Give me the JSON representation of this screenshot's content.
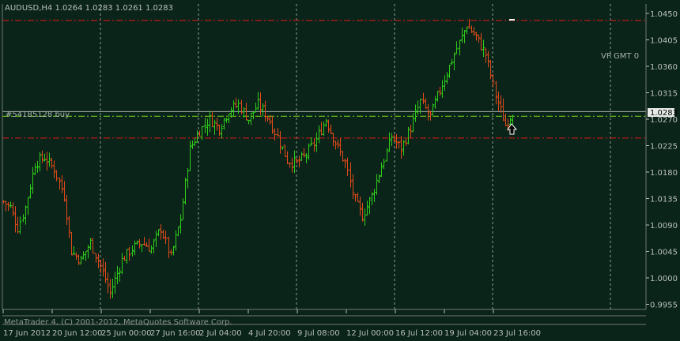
{
  "header": {
    "title": "AUDUSD,H4  1.0264 1.0283 1.0261 1.0283"
  },
  "annotations": {
    "vp_label": "VP GMT 0",
    "order_label": "#54185128 buy",
    "current_price_label": "1.0283",
    "copyright": "MetaTrader 4, (C) 2001-2012, MetaQuotes Software Corp."
  },
  "colors": {
    "background": "#0b2419",
    "grid": "#8a9a94",
    "bull": "#2ecc1a",
    "bear": "#e04a1a",
    "text": "#b8bfbc",
    "red_level": "#e01818",
    "green_level": "#7ad81a",
    "bid_line": "#a8b3ad"
  },
  "chart_data": {
    "type": "candlestick",
    "symbol": "AUDUSD",
    "timeframe": "H4",
    "ylim": [
      0.9945,
      1.046
    ],
    "y_ticks": [
      "1.0450",
      "1.0405",
      "1.0360",
      "1.0315",
      "1.0270",
      "1.0225",
      "1.0180",
      "1.0135",
      "1.0090",
      "1.0045",
      "1.0000",
      "0.9955"
    ],
    "x_ticks": [
      "17 Jun 2012",
      "20 Jun 12:00",
      "25 Jun 00:00",
      "27 Jun 16:00",
      "2 Jul 04:00",
      "4 Jul 20:00",
      "9 Jul 08:00",
      "12 Jul 00:00",
      "16 Jul 12:00",
      "19 Jul 04:00",
      "23 Jul 16:00"
    ],
    "levels": [
      {
        "name": "take-profit",
        "price": 1.0438
      },
      {
        "name": "order-open",
        "price": 1.0275
      },
      {
        "name": "stop-loss",
        "price": 1.0238
      }
    ],
    "current_price": 1.0283,
    "anchors": [
      [
        0,
        1.013
      ],
      [
        3,
        1.012
      ],
      [
        6,
        1.0085
      ],
      [
        9,
        1.012
      ],
      [
        13,
        1.0195
      ],
      [
        17,
        1.0205
      ],
      [
        21,
        1.0185
      ],
      [
        25,
        1.014
      ],
      [
        28,
        1.0045
      ],
      [
        32,
        1.003
      ],
      [
        36,
        1.006
      ],
      [
        40,
        1.002
      ],
      [
        44,
        0.9975
      ],
      [
        49,
        1.003
      ],
      [
        53,
        1.005
      ],
      [
        57,
        1.006
      ],
      [
        61,
        1.005
      ],
      [
        65,
        1.0085
      ],
      [
        69,
        1.0035
      ],
      [
        73,
        1.01
      ],
      [
        77,
        1.022
      ],
      [
        81,
        1.025
      ],
      [
        85,
        1.027
      ],
      [
        89,
        1.0255
      ],
      [
        93,
        1.0285
      ],
      [
        97,
        1.0295
      ],
      [
        101,
        1.027
      ],
      [
        105,
        1.0295
      ],
      [
        109,
        1.0275
      ],
      [
        113,
        1.024
      ],
      [
        117,
        1.02
      ],
      [
        121,
        1.0195
      ],
      [
        125,
        1.021
      ],
      [
        129,
        1.0235
      ],
      [
        133,
        1.027
      ],
      [
        137,
        1.023
      ],
      [
        141,
        1.0195
      ],
      [
        145,
        1.013
      ],
      [
        148,
        1.0105
      ],
      [
        152,
        1.014
      ],
      [
        156,
        1.019
      ],
      [
        160,
        1.024
      ],
      [
        164,
        1.022
      ],
      [
        168,
        1.0255
      ],
      [
        172,
        1.03
      ],
      [
        176,
        1.0275
      ],
      [
        180,
        1.032
      ],
      [
        184,
        1.036
      ],
      [
        188,
        1.04
      ],
      [
        191,
        1.043
      ],
      [
        195,
        1.041
      ],
      [
        199,
        1.038
      ],
      [
        203,
        1.031
      ],
      [
        207,
        1.026
      ],
      [
        210,
        1.0283
      ]
    ]
  }
}
